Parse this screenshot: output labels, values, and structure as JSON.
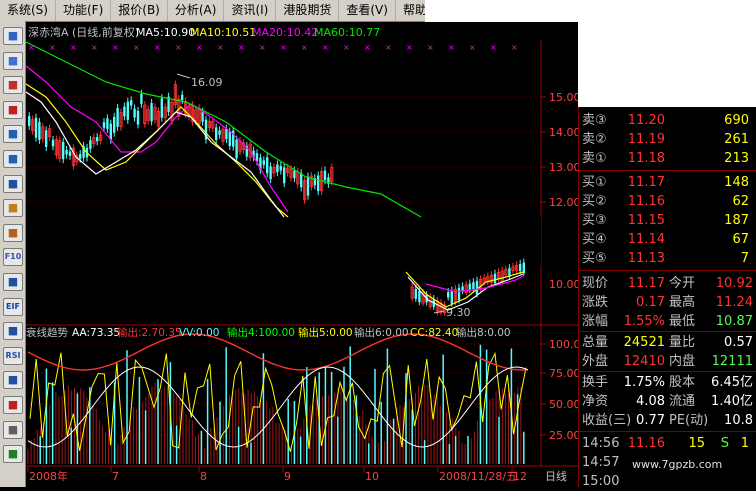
{
  "menu": [
    "系统(S)",
    "功能(F)",
    "报价(B)",
    "分析(A)",
    "资讯(I)",
    "港股期货",
    "查看(V)",
    "帮助(H)"
  ],
  "toolbar_icons": [
    "chart-icon",
    "grid-icon",
    "line-chart-icon",
    "candle-icon",
    "report-icon",
    "table-icon",
    "list-icon",
    "f10-icon",
    "people-icon",
    "globe-icon",
    "book-icon",
    "etf-icon",
    "window-icon",
    "rsi-icon",
    "chart2-icon",
    "stop-icon",
    "wrench-icon",
    "exit-icon"
  ],
  "toolbar_text": {
    "etf": "EIF",
    "rsi": "RSI",
    "f10": "F10"
  },
  "header": {
    "title": "深赤湾A",
    "mode": "(日线,前复权)",
    "ma5": "MA5:10.90",
    "ma10": "MA10:10.51",
    "ma20": "MA20:10.42",
    "ma60": "MA60:10.77"
  },
  "price_axis": [
    "15.00",
    "14.00",
    "13.00",
    "12.00",
    "10.00"
  ],
  "high_label": "16.09",
  "low_label": "9.30",
  "indicator": {
    "name": "衰线趋势",
    "aa": "AA:73.35",
    "out": "输出:2.70.35",
    "vv": "VV:0.00",
    "out4": "输出4:100.00",
    "out5": "输出5:0.00",
    "out6": "输出6:0.00",
    "cc": "CC:82.40",
    "out8": "输出8:0.00",
    "axis": [
      "100.00",
      "75.00",
      "50.00",
      "25.00"
    ]
  },
  "date_axis": [
    "2008年",
    "7",
    "8",
    "9",
    "10",
    "2008/11/28/五",
    "12"
  ],
  "period": "日线",
  "quote": {
    "sells": [
      {
        "label": "卖③",
        "price": "11.20",
        "vol": "690"
      },
      {
        "label": "卖②",
        "price": "11.19",
        "vol": "261"
      },
      {
        "label": "卖①",
        "price": "11.18",
        "vol": "213"
      }
    ],
    "buys": [
      {
        "label": "买①",
        "price": "11.17",
        "vol": "148"
      },
      {
        "label": "买②",
        "price": "11.16",
        "vol": "62"
      },
      {
        "label": "买③",
        "price": "11.15",
        "vol": "187"
      },
      {
        "label": "买④",
        "price": "11.14",
        "vol": "67"
      },
      {
        "label": "买⑤",
        "price": "11.13",
        "vol": "7"
      }
    ],
    "stats": [
      {
        "l1": "现价",
        "v1": "11.17",
        "l2": "今开",
        "v2": "10.92"
      },
      {
        "l1": "涨跌",
        "v1": "0.17",
        "l2": "最高",
        "v2": "11.24"
      },
      {
        "l1": "涨幅",
        "v1": "1.55%",
        "l2": "最低",
        "v2": "10.87"
      },
      {
        "l1": "总量",
        "v1": "24521",
        "l2": "量比",
        "v2": "0.57"
      },
      {
        "l1": "外盘",
        "v1": "12410",
        "l2": "内盘",
        "v2": "12111"
      },
      {
        "l1": "换手",
        "v1": "1.75%",
        "l2": "股本",
        "v2": "6.45亿"
      },
      {
        "l1": "净资",
        "v1": "4.08",
        "l2": "流通",
        "v2": "1.40亿"
      },
      {
        "l1": "收益(三)",
        "v1": "0.77",
        "l2": "PE(动)",
        "v2": "10.8"
      }
    ],
    "ticks": [
      {
        "time": "14:56",
        "price": "11.16",
        "vol": "15",
        "flag": "S",
        "extra": "1"
      },
      {
        "time": "14:57",
        "price": "",
        "vol": "",
        "flag": "",
        "extra": ""
      },
      {
        "time": "15:00",
        "price": "",
        "vol": "",
        "flag": "",
        "extra": ""
      }
    ]
  },
  "watermark": "www.7gpzb.com",
  "colors": {
    "up": "#ff3232",
    "down": "#54fcfc",
    "ma5": "#ffffff",
    "ma10": "#ffff00",
    "ma20": "#ff00ff",
    "ma60": "#00e600",
    "value": "#ffff00",
    "label": "#c0c0c0"
  }
}
